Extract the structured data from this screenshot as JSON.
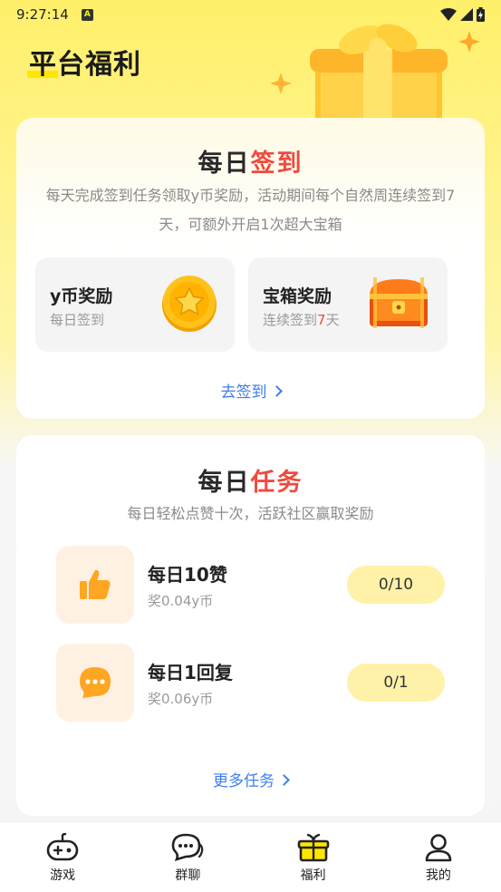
{
  "status_bar": {
    "time": "9:27:14",
    "notification_icon": "A"
  },
  "header": {
    "title": "平台福利"
  },
  "signin_card": {
    "title_part1": "每日",
    "title_part2": "签到",
    "description": "每天完成签到任务领取y币奖励，活动期间每个自然周连续签到7天，可额外开启1次超大宝箱",
    "rewards": [
      {
        "title": "y币奖励",
        "subtitle": "每日签到",
        "icon": "coin-icon"
      },
      {
        "title": "宝箱奖励",
        "subtitle_prefix": "连续签到",
        "subtitle_highlight": "7",
        "subtitle_suffix": "天",
        "icon": "treasure-chest-icon"
      }
    ],
    "link_label": "去签到"
  },
  "tasks_card": {
    "title_part1": "每日",
    "title_part2": "任务",
    "description": "每日轻松点赞十次，活跃社区赢取奖励",
    "tasks": [
      {
        "name": "每日10赞",
        "reward": "奖0.04y币",
        "progress": "0/10",
        "icon": "thumbs-up-icon"
      },
      {
        "name": "每日1回复",
        "reward": "奖0.06y币",
        "progress": "0/1",
        "icon": "chat-bubble-icon"
      }
    ],
    "link_label": "更多任务"
  },
  "bottom_nav": {
    "items": [
      {
        "label": "游戏",
        "icon": "gamepad-icon"
      },
      {
        "label": "群聊",
        "icon": "group-chat-icon"
      },
      {
        "label": "福利",
        "icon": "gift-icon",
        "active": true
      },
      {
        "label": "我的",
        "icon": "person-icon"
      }
    ]
  },
  "colors": {
    "accent_yellow": "#ffe600",
    "title_red": "#f04a3e",
    "link_blue": "#3d7ef0"
  }
}
